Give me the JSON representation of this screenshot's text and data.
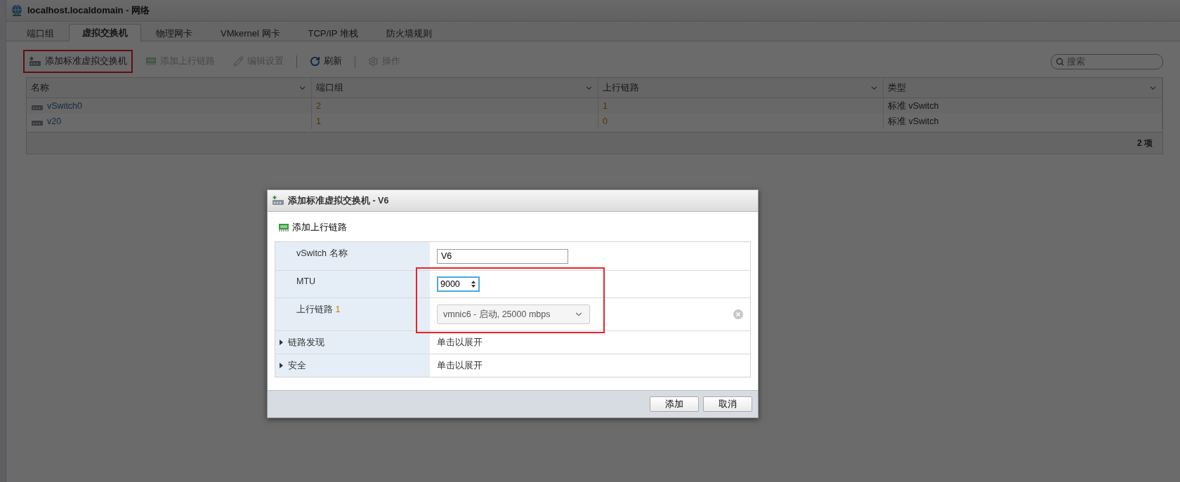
{
  "window": {
    "title": "localhost.localdomain - 网络"
  },
  "tabs": [
    {
      "label": "端口组",
      "selected": false
    },
    {
      "label": "虚拟交换机",
      "selected": true
    },
    {
      "label": "物理网卡",
      "selected": false
    },
    {
      "label": "VMkernel 网卡",
      "selected": false
    },
    {
      "label": "TCP/IP 堆栈",
      "selected": false
    },
    {
      "label": "防火墙规则",
      "selected": false
    }
  ],
  "toolbar": {
    "items": [
      {
        "kind": "add-switch",
        "label": "添加标准虚拟交换机",
        "disabled": false,
        "highlighted": true
      },
      {
        "kind": "add-uplink",
        "label": "添加上行链路",
        "disabled": true,
        "highlighted": false
      },
      {
        "kind": "edit",
        "label": "编辑设置",
        "disabled": true,
        "highlighted": false
      },
      {
        "kind": "refresh",
        "label": "刷新",
        "disabled": false,
        "highlighted": false
      },
      {
        "kind": "actions",
        "label": "操作",
        "disabled": true,
        "highlighted": false
      }
    ],
    "search": {
      "placeholder": "搜索"
    }
  },
  "table": {
    "columns": [
      "名称",
      "端口组",
      "上行链路",
      "类型"
    ],
    "rows": [
      {
        "name": "vSwitch0",
        "port_groups": "2",
        "uplinks": "1",
        "type": "标准 vSwitch"
      },
      {
        "name": "v20",
        "port_groups": "1",
        "uplinks": "0",
        "type": "标准 vSwitch"
      }
    ],
    "footer": "2 项"
  },
  "dialog": {
    "title": "添加标准虚拟交换机 - V6",
    "add_uplink": "添加上行链路",
    "rows": [
      {
        "kind": "text",
        "label": "vSwitch 名称",
        "value": "V6",
        "focused": false,
        "highlighted": false
      },
      {
        "kind": "number",
        "label": "MTU",
        "value": "9000",
        "focused": true,
        "highlighted": true
      },
      {
        "kind": "select",
        "label": "上行链路",
        "number": "1",
        "value": "vmnic6 - 启动, 25000 mbps",
        "highlighted": true
      },
      {
        "kind": "expander",
        "label": "链路发现",
        "value": "单击以展开",
        "expanded": false,
        "highlighted": false
      },
      {
        "kind": "expander",
        "label": "安全",
        "value": "单击以展开",
        "expanded": false,
        "highlighted": false
      }
    ],
    "buttons": [
      "添加",
      "取消"
    ]
  }
}
